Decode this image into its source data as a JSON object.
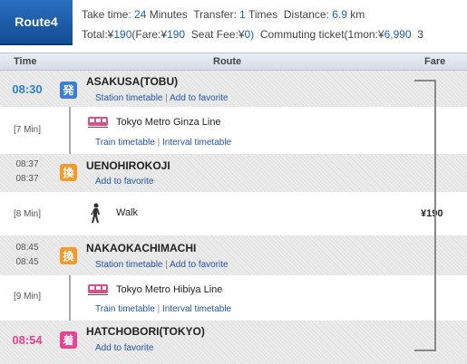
{
  "route": {
    "label": "Route4",
    "take_time_label": "Take time:",
    "take_time_value": "24",
    "take_time_unit": "Minutes",
    "transfer_label": "Transfer:",
    "transfer_value": "1",
    "transfer_unit": "Times",
    "distance_label": "Distance:",
    "distance_value": "6.9",
    "distance_unit": "km",
    "total_label": "Total:¥",
    "total_value": "190",
    "fare_label": "(Fare:¥",
    "fare_value": "190",
    "seat_label": "Seat Fee:¥",
    "seat_value": "0)",
    "commute_label": "Commuting ticket(1mon:¥",
    "commute_value": "6,990",
    "commute_more": "3"
  },
  "header": {
    "time": "Time",
    "route": "Route",
    "fare": "Fare"
  },
  "stations": [
    {
      "name": "ASAKUSA(TOBU)",
      "time": "08:30",
      "badge": "発",
      "link1": "Station timetable",
      "link2": "Add to favorite"
    },
    {
      "name": "UENOHIROKOJI",
      "time_arr": "08:37",
      "time_dep": "08:37",
      "badge": "換",
      "link2": "Add to favorite"
    },
    {
      "name": "NAKAOKACHIMACHI",
      "time_arr": "08:45",
      "time_dep": "08:45",
      "badge": "換",
      "link1": "Station timetable",
      "link2": "Add to favorite"
    },
    {
      "name": "HATCHOBORI(TOKYO)",
      "time": "08:54",
      "badge": "着",
      "link2": "Add to favorite"
    }
  ],
  "segments": [
    {
      "duration": "[7 Min]",
      "line": "Tokyo Metro Ginza Line",
      "link1": "Train timetable",
      "link2": "Interval timetable"
    },
    {
      "duration": "[8 Min]",
      "line": "Walk"
    },
    {
      "duration": "[9 Min]",
      "line": "Tokyo Metro Hibiya Line",
      "link1": "Train timetable",
      "link2": "Interval timetable"
    }
  ],
  "fare": "¥190",
  "colors": {
    "accent": "#2d7fd0",
    "arrive": "#e8438e",
    "transfer": "#f39a2b",
    "train": "#d94f8a"
  }
}
